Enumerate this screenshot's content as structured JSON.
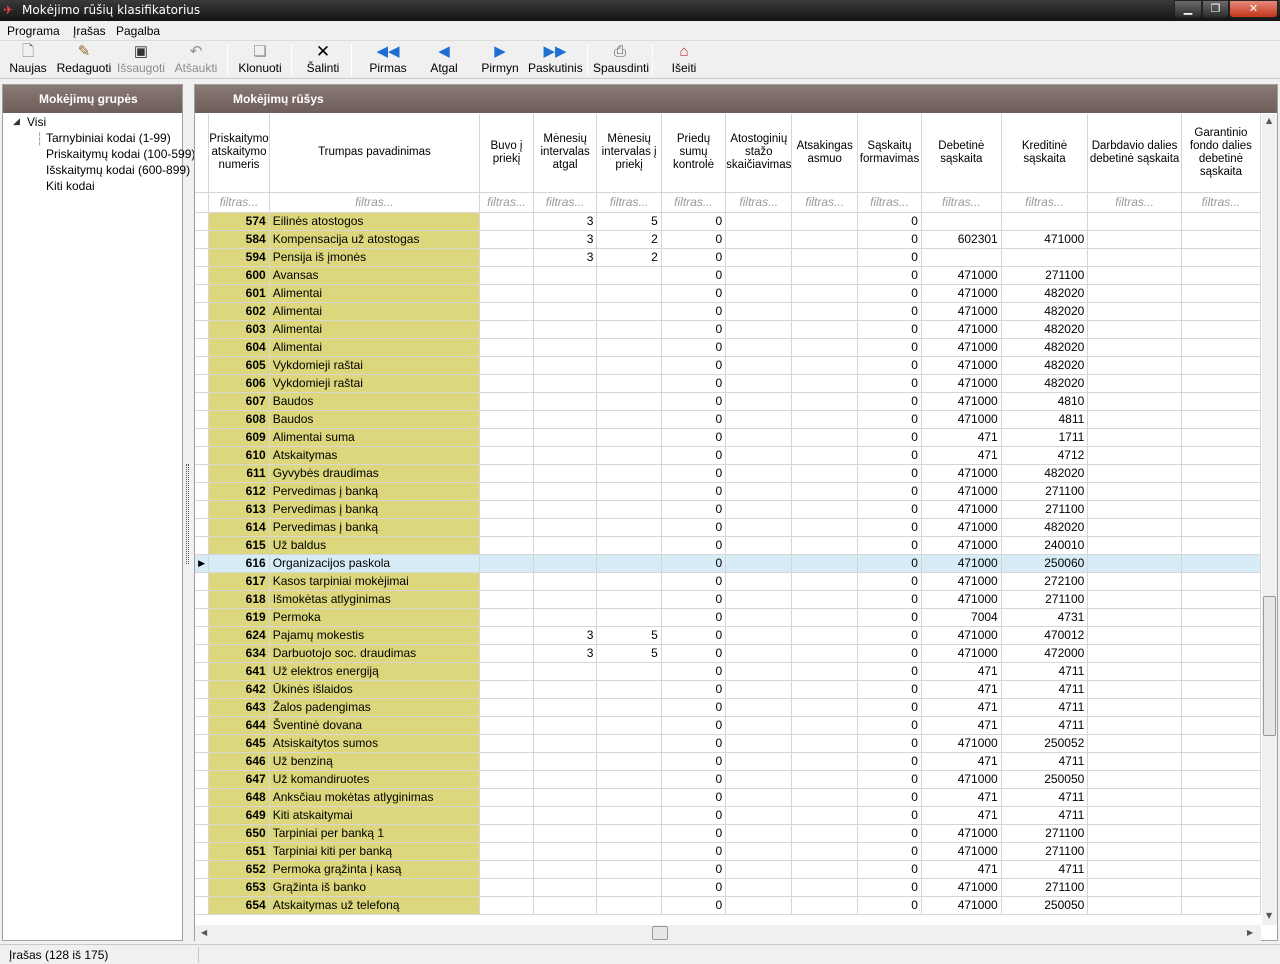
{
  "window": {
    "title": "Mokėjimo rūšių klasifikatorius"
  },
  "menu": [
    "Programa",
    "Įrašas",
    "Pagalba"
  ],
  "toolbar": [
    {
      "label": "Naujas",
      "icon": "new-document-icon",
      "enabled": true
    },
    {
      "label": "Redaguoti",
      "icon": "edit-icon",
      "enabled": true
    },
    {
      "label": "Išsaugoti",
      "icon": "save-icon",
      "enabled": false
    },
    {
      "label": "Atšaukti",
      "icon": "undo-icon",
      "enabled": false
    },
    {
      "label": "Klonuoti",
      "icon": "clone-icon",
      "enabled": true
    },
    {
      "label": "Šalinti",
      "icon": "delete-icon",
      "enabled": true
    },
    {
      "label": "Pirmas",
      "icon": "first-record-icon",
      "enabled": true
    },
    {
      "label": "Atgal",
      "icon": "previous-record-icon",
      "enabled": true
    },
    {
      "label": "Pirmyn",
      "icon": "next-record-icon",
      "enabled": true
    },
    {
      "label": "Paskutinis",
      "icon": "last-record-icon",
      "enabled": true
    },
    {
      "label": "Spausdinti",
      "icon": "print-icon",
      "enabled": true
    },
    {
      "label": "Išeiti",
      "icon": "exit-icon",
      "enabled": true
    }
  ],
  "left_panel": {
    "title": "Mokėjimų grupės",
    "tree": {
      "root": "Visi",
      "children": [
        "Tarnybiniai kodai (1-99)",
        "Priskaitymų kodai (100-599)",
        "Išskaitymų  kodai (600-899)",
        "Kiti kodai"
      ]
    }
  },
  "right_panel": {
    "title": "Mokėjimų rūšys",
    "columns": [
      "Priskaitymo atskaitymo numeris",
      "Trumpas pavadinimas",
      "Buvo į priekį",
      "Mėnesių intervalas atgal",
      "Mėnesių intervalas į priekį",
      "Priedų sumų kontrolė",
      "Atostoginių stažo skaičiavimas",
      "Atsakingas asmuo",
      "Sąskaitų formavimas",
      "Debetinė sąskaita",
      "Kreditinė sąskaita",
      "Darbdavio dalies debetinė sąskaita",
      "Garantinio fondo dalies debetinė sąskaita"
    ],
    "filter_placeholder": "filtras...",
    "selected_code": "616",
    "rows": [
      [
        "574",
        "Eilinės atostogos",
        "",
        "3",
        "5",
        "0",
        "",
        "",
        "0",
        "",
        ""
      ],
      [
        "584",
        "Kompensacija už atostogas",
        "",
        "3",
        "2",
        "0",
        "",
        "",
        "0",
        "602301",
        "471000"
      ],
      [
        "594",
        "Pensija iš įmonės",
        "",
        "3",
        "2",
        "0",
        "",
        "",
        "0",
        "",
        ""
      ],
      [
        "600",
        "Avansas",
        "",
        "",
        "",
        "0",
        "",
        "",
        "0",
        "471000",
        "271100"
      ],
      [
        "601",
        "Alimentai",
        "",
        "",
        "",
        "0",
        "",
        "",
        "0",
        "471000",
        "482020"
      ],
      [
        "602",
        "Alimentai",
        "",
        "",
        "",
        "0",
        "",
        "",
        "0",
        "471000",
        "482020"
      ],
      [
        "603",
        "Alimentai",
        "",
        "",
        "",
        "0",
        "",
        "",
        "0",
        "471000",
        "482020"
      ],
      [
        "604",
        "Alimentai",
        "",
        "",
        "",
        "0",
        "",
        "",
        "0",
        "471000",
        "482020"
      ],
      [
        "605",
        "Vykdomieji raštai",
        "",
        "",
        "",
        "0",
        "",
        "",
        "0",
        "471000",
        "482020"
      ],
      [
        "606",
        "Vykdomieji raštai",
        "",
        "",
        "",
        "0",
        "",
        "",
        "0",
        "471000",
        "482020"
      ],
      [
        "607",
        "Baudos",
        "",
        "",
        "",
        "0",
        "",
        "",
        "0",
        "471000",
        "4810"
      ],
      [
        "608",
        "Baudos",
        "",
        "",
        "",
        "0",
        "",
        "",
        "0",
        "471000",
        "4811"
      ],
      [
        "609",
        "Alimentai suma",
        "",
        "",
        "",
        "0",
        "",
        "",
        "0",
        "471",
        "1711"
      ],
      [
        "610",
        "Atskaitymas",
        "",
        "",
        "",
        "0",
        "",
        "",
        "0",
        "471",
        "4712"
      ],
      [
        "611",
        "Gyvybės draudimas",
        "",
        "",
        "",
        "0",
        "",
        "",
        "0",
        "471000",
        "482020"
      ],
      [
        "612",
        "Pervedimas į banką",
        "",
        "",
        "",
        "0",
        "",
        "",
        "0",
        "471000",
        "271100"
      ],
      [
        "613",
        "Pervedimas į banką",
        "",
        "",
        "",
        "0",
        "",
        "",
        "0",
        "471000",
        "271100"
      ],
      [
        "614",
        "Pervedimas į banką",
        "",
        "",
        "",
        "0",
        "",
        "",
        "0",
        "471000",
        "482020"
      ],
      [
        "615",
        "Už baldus",
        "",
        "",
        "",
        "0",
        "",
        "",
        "0",
        "471000",
        "240010"
      ],
      [
        "616",
        "Organizacijos paskola",
        "",
        "",
        "",
        "0",
        "",
        "",
        "0",
        "471000",
        "250060"
      ],
      [
        "617",
        "Kasos tarpiniai mokėjimai",
        "",
        "",
        "",
        "0",
        "",
        "",
        "0",
        "471000",
        "272100"
      ],
      [
        "618",
        "Išmokėtas atlyginimas",
        "",
        "",
        "",
        "0",
        "",
        "",
        "0",
        "471000",
        "271100"
      ],
      [
        "619",
        "Permoka",
        "",
        "",
        "",
        "0",
        "",
        "",
        "0",
        "7004",
        "4731"
      ],
      [
        "624",
        "Pajamų mokestis",
        "",
        "3",
        "5",
        "0",
        "",
        "",
        "0",
        "471000",
        "470012"
      ],
      [
        "634",
        "Darbuotojo soc. draudimas",
        "",
        "3",
        "5",
        "0",
        "",
        "",
        "0",
        "471000",
        "472000"
      ],
      [
        "641",
        "Už elektros energiją",
        "",
        "",
        "",
        "0",
        "",
        "",
        "0",
        "471",
        "4711"
      ],
      [
        "642",
        "Ūkinės išlaidos",
        "",
        "",
        "",
        "0",
        "",
        "",
        "0",
        "471",
        "4711"
      ],
      [
        "643",
        "Žalos padengimas",
        "",
        "",
        "",
        "0",
        "",
        "",
        "0",
        "471",
        "4711"
      ],
      [
        "644",
        "Šventinė dovana",
        "",
        "",
        "",
        "0",
        "",
        "",
        "0",
        "471",
        "4711"
      ],
      [
        "645",
        "Atsiskaitytos sumos",
        "",
        "",
        "",
        "0",
        "",
        "",
        "0",
        "471000",
        "250052"
      ],
      [
        "646",
        "Už benziną",
        "",
        "",
        "",
        "0",
        "",
        "",
        "0",
        "471",
        "4711"
      ],
      [
        "647",
        "Už komandiruotes",
        "",
        "",
        "",
        "0",
        "",
        "",
        "0",
        "471000",
        "250050"
      ],
      [
        "648",
        "Anksčiau mokėtas atlyginimas",
        "",
        "",
        "",
        "0",
        "",
        "",
        "0",
        "471",
        "4711"
      ],
      [
        "649",
        "Kiti atskaitymai",
        "",
        "",
        "",
        "0",
        "",
        "",
        "0",
        "471",
        "4711"
      ],
      [
        "650",
        "Tarpiniai per banką 1",
        "",
        "",
        "",
        "0",
        "",
        "",
        "0",
        "471000",
        "271100"
      ],
      [
        "651",
        "Tarpiniai kiti per banką",
        "",
        "",
        "",
        "0",
        "",
        "",
        "0",
        "471000",
        "271100"
      ],
      [
        "652",
        "Permoka grąžinta į kasą",
        "",
        "",
        "",
        "0",
        "",
        "",
        "0",
        "471",
        "4711"
      ],
      [
        "653",
        "Grąžinta iš banko",
        "",
        "",
        "",
        "0",
        "",
        "",
        "0",
        "471000",
        "271100"
      ],
      [
        "654",
        "Atskaitymas už telefoną",
        "",
        "",
        "",
        "0",
        "",
        "",
        "0",
        "471000",
        "250050"
      ]
    ]
  },
  "status": {
    "text": "Įrašas (128 iš 175)"
  }
}
